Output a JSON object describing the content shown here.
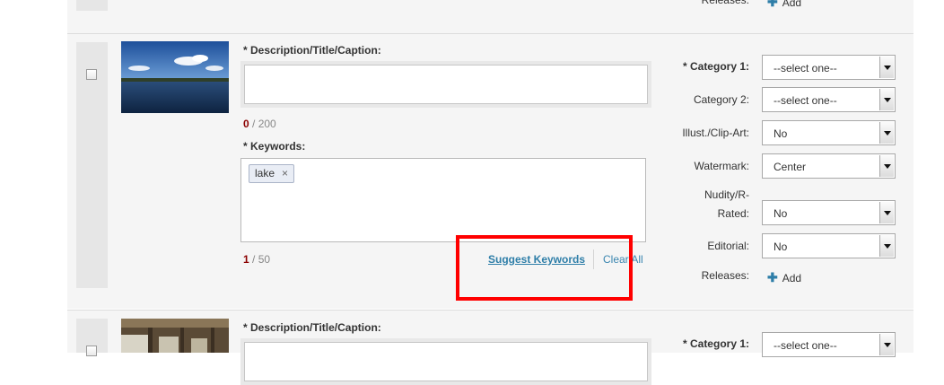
{
  "rows": [
    {
      "releases": {
        "label": "Releases:",
        "add_label": "Add"
      }
    },
    {
      "description": {
        "label": "* Description/Title/Caption:",
        "value": ""
      },
      "description_counter": {
        "count": "0",
        "max": "/ 200"
      },
      "keywords": {
        "label": "* Keywords:",
        "tags": [
          {
            "text": "lake",
            "remove": "×"
          }
        ]
      },
      "keywords_counter": {
        "count": "1",
        "max": "/ 50"
      },
      "actions": {
        "suggest": "Suggest Keywords",
        "clear": "Clear All"
      },
      "fields": {
        "category1": {
          "label": "* Category 1:",
          "value": "--select one--"
        },
        "category2": {
          "label": "Category 2:",
          "value": "--select one--"
        },
        "illust": {
          "label": "Illust./Clip-Art:",
          "value": "No"
        },
        "watermark": {
          "label": "Watermark:",
          "value": "Center"
        },
        "nudity": {
          "label_line1": "Nudity/R-",
          "label_line2": "Rated:",
          "value": "No"
        },
        "editorial": {
          "label": "Editorial:",
          "value": "No"
        },
        "releases": {
          "label": "Releases:",
          "add_label": "Add"
        }
      }
    },
    {
      "description": {
        "label": "* Description/Title/Caption:"
      },
      "fields": {
        "category1": {
          "label": "* Category 1:",
          "value": "--select one--"
        }
      }
    }
  ],
  "colors": {
    "highlight": "#ff0000",
    "link": "#2e7ea8",
    "counter_accent": "#8b0000",
    "panel": "#f5f5f5"
  },
  "icons": {
    "checkbox": "checkbox-icon",
    "add": "plus-icon",
    "dropdown": "chevron-down-icon"
  }
}
